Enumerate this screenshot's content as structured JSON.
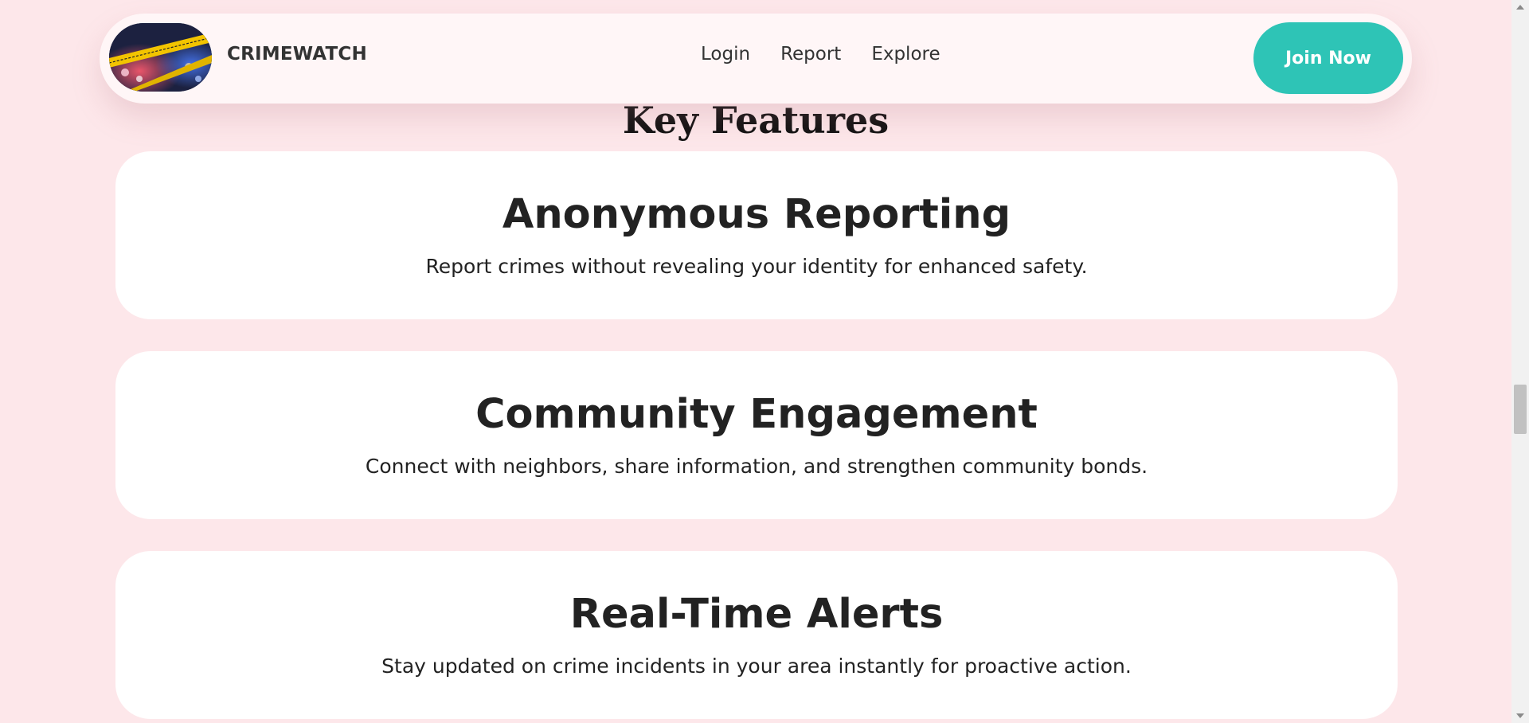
{
  "navbar": {
    "brand": "CRIMEWATCH",
    "logo_icon": "police-tape-night-photo",
    "links": [
      "Login",
      "Report",
      "Explore"
    ],
    "cta_label": "Join Now",
    "cta_color": "#2ec4b6"
  },
  "features": {
    "title": "Key Features",
    "items": [
      {
        "heading": "Anonymous Reporting",
        "description": "Report crimes without revealing your identity for enhanced safety."
      },
      {
        "heading": "Community Engagement",
        "description": "Connect with neighbors, share information, and strengthen community bonds."
      },
      {
        "heading": "Real-Time Alerts",
        "description": "Stay updated on crime incidents in your area instantly for proactive action."
      }
    ]
  },
  "colors": {
    "background": "#fde7ea",
    "navbar_bg": "#fff6f7",
    "card_bg": "#ffffff",
    "accent": "#2ec4b6"
  }
}
